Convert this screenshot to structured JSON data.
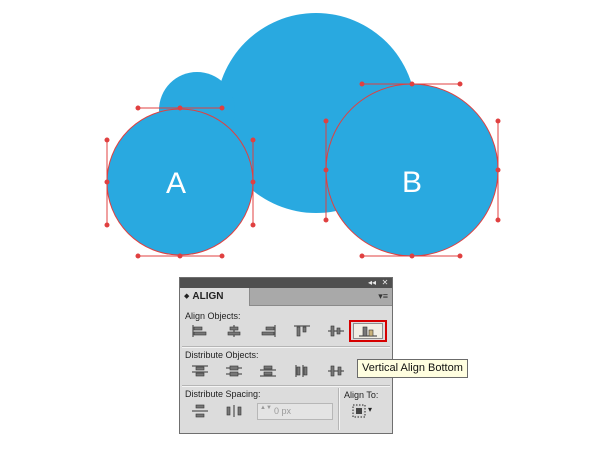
{
  "artboard": {
    "shape_a_label": "A",
    "shape_b_label": "B",
    "fill_color": "#29a9e0",
    "selection_color": "#e04040"
  },
  "panel": {
    "tab_label": "ALIGN",
    "tab_arrows": "◆",
    "collapse_glyph": "◂◂",
    "close_glyph": "✕",
    "menu_glyph": "▾≡",
    "align_objects_label": "Align Objects:",
    "distribute_objects_label": "Distribute Objects:",
    "distribute_spacing_label": "Distribute Spacing:",
    "align_to_label": "Align To:",
    "spacing_value": "0 px",
    "stepper_glyph": "▲▼",
    "align_to_dropdown": "▾"
  },
  "tooltip": {
    "text": "Vertical Align Bottom"
  }
}
